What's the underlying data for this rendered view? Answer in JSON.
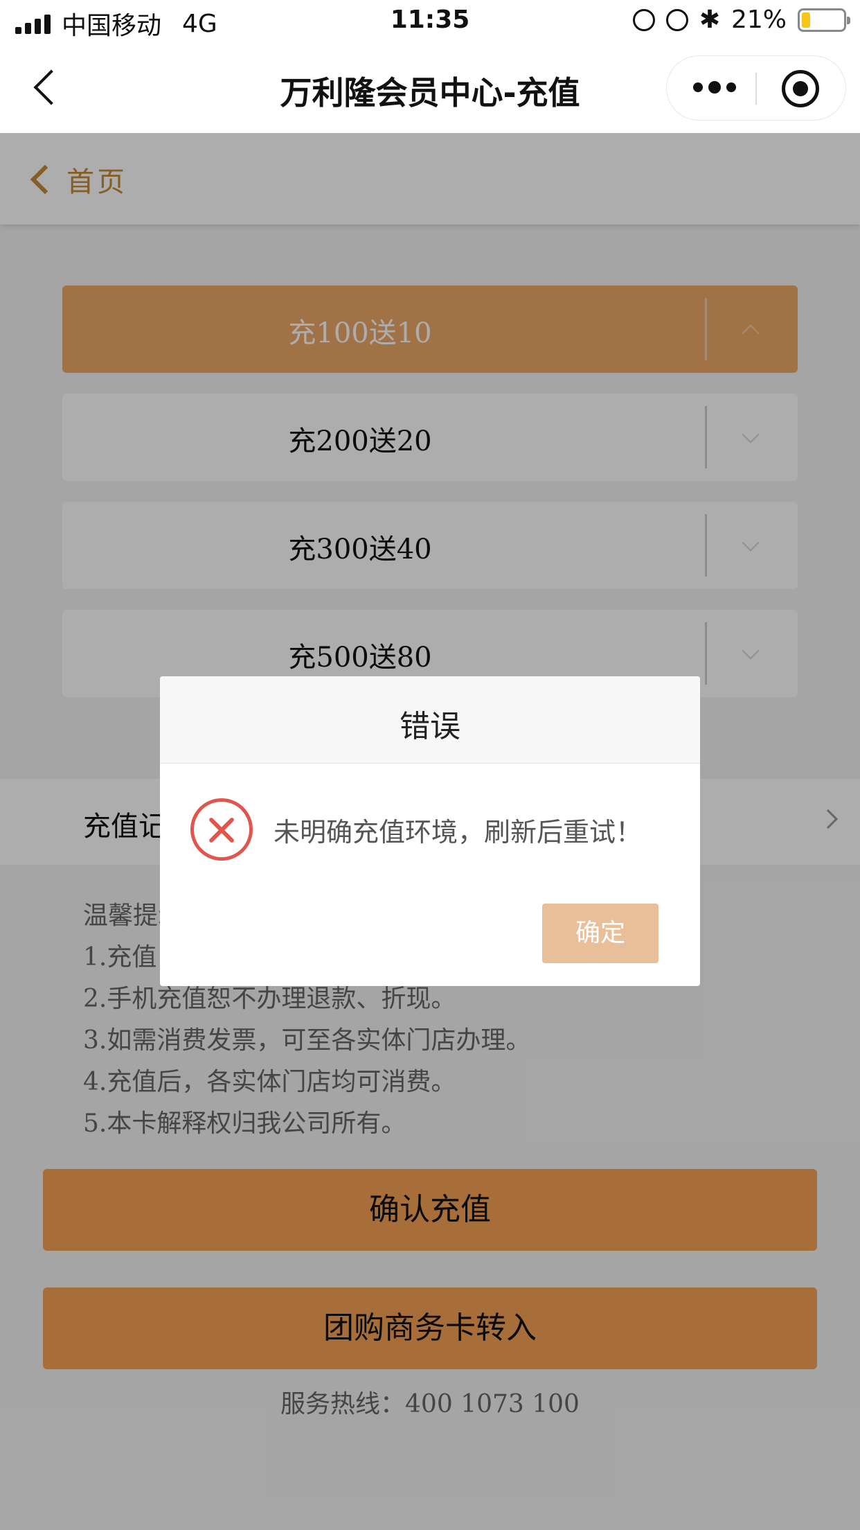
{
  "status_bar": {
    "carrier": "中国移动",
    "network": "4G",
    "time": "11:35",
    "battery": "21%",
    "battery_level": 0.21
  },
  "nav": {
    "title": "万利隆会员中心-充值",
    "more_icon": "more-dots-icon",
    "close_icon": "target-circle-icon"
  },
  "home": {
    "label": "首页"
  },
  "options": [
    {
      "label": "充100送10",
      "selected": true
    },
    {
      "label": "充200送20",
      "selected": false
    },
    {
      "label": "充300送40",
      "selected": false
    },
    {
      "label": "充500送80",
      "selected": false
    }
  ],
  "records": {
    "label": "充值记录"
  },
  "tips": {
    "heading": "温馨提示：",
    "items": [
      "1.充值",
      "2.手机充值恕不办理退款、折现。",
      "3.如需消费发票，可至各实体门店办理。",
      "4.充值后，各实体门店均可消费。",
      "5.本卡解释权归我公司所有。"
    ]
  },
  "buttons": {
    "confirm": "确认充值",
    "group_card": "团购商务卡转入"
  },
  "hotline": "服务热线：400 1073 100",
  "dialog": {
    "title": "错误",
    "message": "未明确充值环境，刷新后重试！",
    "ok": "确定",
    "icon": "error-x-icon"
  },
  "colors": {
    "accent": "#eea868",
    "button": "#f6a356",
    "error": "#e0564e",
    "link": "#c58a3a"
  }
}
